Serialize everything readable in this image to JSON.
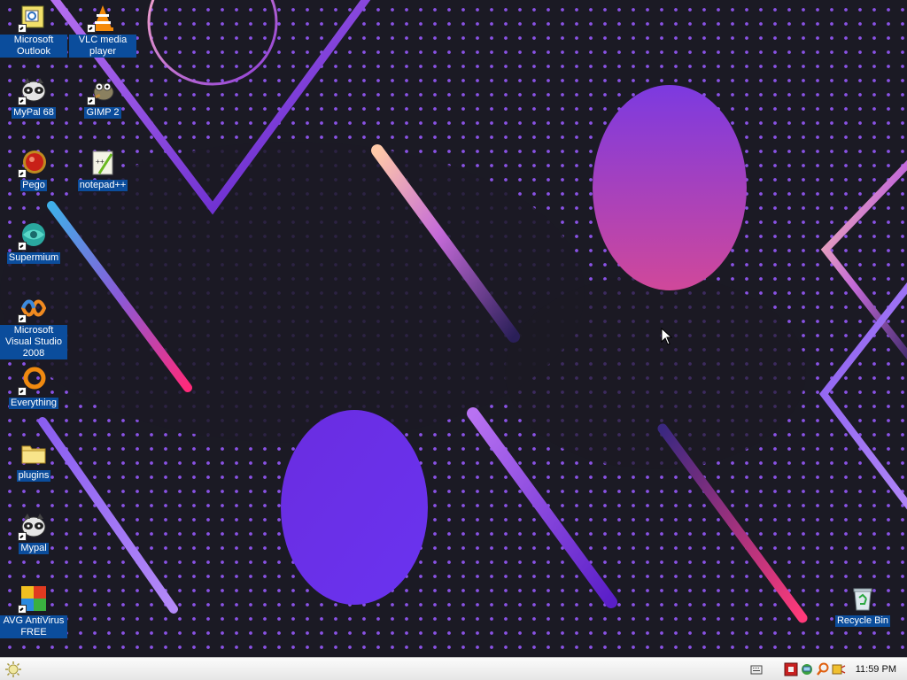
{
  "desktop": {
    "icons": [
      {
        "label": "Microsoft Outlook",
        "icon": "outlook-icon"
      },
      {
        "label": "VLC media player",
        "icon": "vlc-icon"
      },
      {
        "label": "MyPal 68",
        "icon": "mypal-icon"
      },
      {
        "label": "GIMP 2",
        "icon": "gimp-icon"
      },
      {
        "label": "Pego",
        "icon": "pego-icon"
      },
      {
        "label": "notepad++",
        "icon": "notepadpp-icon"
      },
      {
        "label": "Supermium",
        "icon": "supermium-icon"
      },
      {
        "label": "Microsoft Visual Studio 2008",
        "icon": "visual-studio-icon"
      },
      {
        "label": "Everything",
        "icon": "everything-icon"
      },
      {
        "label": "plugins",
        "icon": "folder-icon"
      },
      {
        "label": "Mypal",
        "icon": "mypal-icon"
      },
      {
        "label": "AVG AntiVirus FREE",
        "icon": "avg-icon"
      },
      {
        "label": "Recycle Bin",
        "icon": "recycle-bin-icon"
      }
    ]
  },
  "taskbar": {
    "start_icon": "start-icon",
    "tray_icons": [
      "keyboard-icon",
      "avg-tray-icon",
      "network-tray-icon",
      "search-tray-icon",
      "volume-tray-icon"
    ],
    "clock": "11:59 PM"
  },
  "colors": {
    "background": "#1b1a24",
    "dots": "#8a52e6",
    "label_highlight": "#0b4d9c",
    "taskbar": "#f2f2f2"
  }
}
